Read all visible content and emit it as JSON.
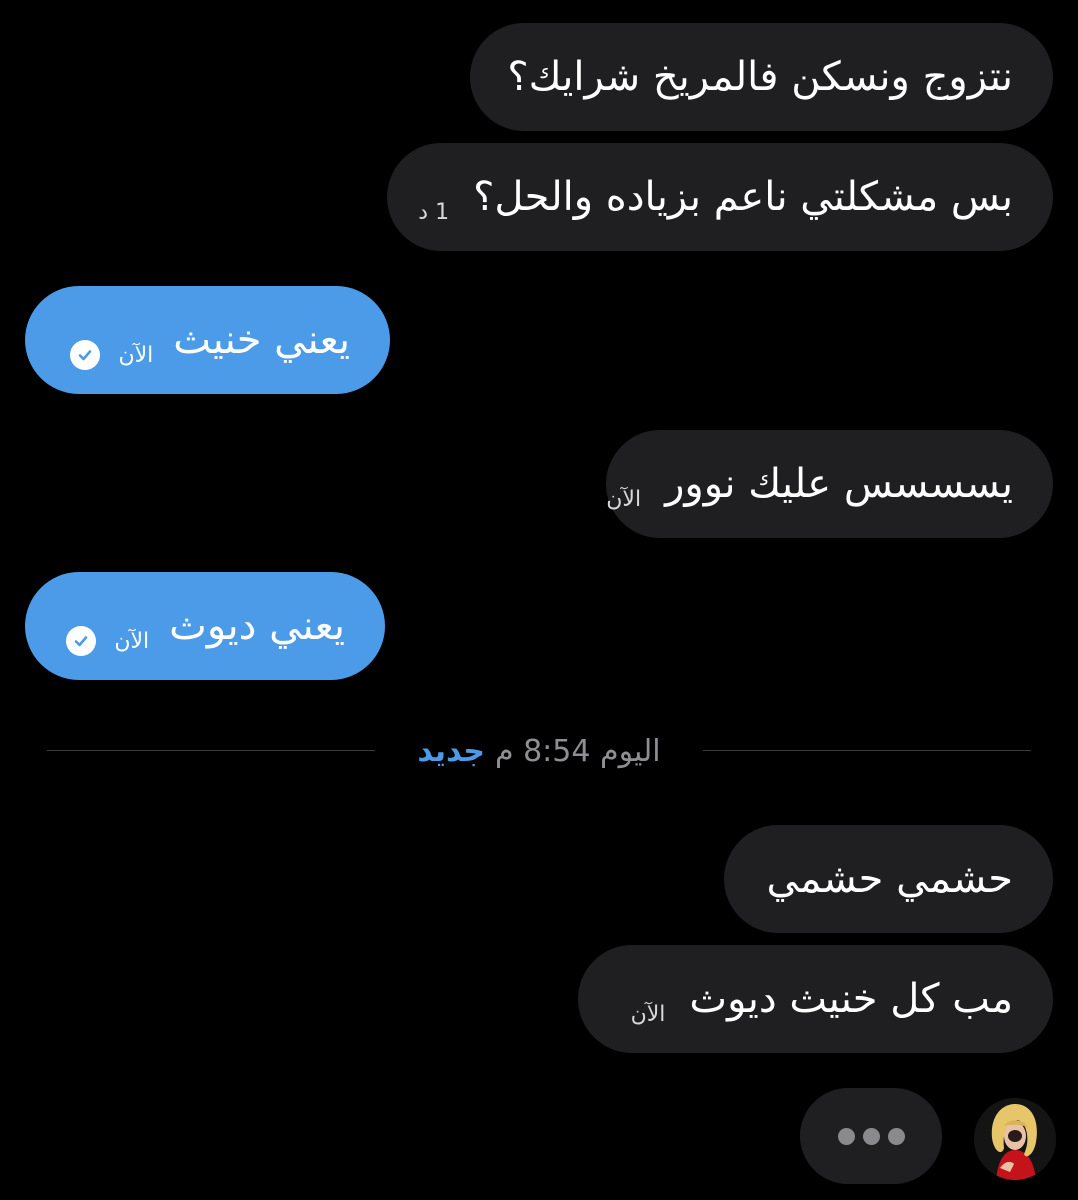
{
  "messages": [
    {
      "side": "incoming",
      "text": "نتزوج ونسكن فالمريخ شرايك؟",
      "time": ""
    },
    {
      "side": "incoming",
      "text": "بس مشكلتي ناعم بزياده والحل؟",
      "time": "1 د"
    },
    {
      "side": "outgoing",
      "text": "يعني خنيث",
      "time": "الآن",
      "status_icon": "read-check-icon"
    },
    {
      "side": "incoming",
      "text": "يسسسس عليك نوور",
      "time": "الآن"
    },
    {
      "side": "outgoing",
      "text": "يعني ديوث",
      "time": "الآن",
      "status_icon": "read-check-icon"
    },
    {
      "side": "incoming",
      "text": "حشمي حشمي",
      "time": ""
    },
    {
      "side": "incoming",
      "text": "مب كل خنيث ديوث",
      "time": "الآن"
    }
  ],
  "divider": {
    "date_label": "اليوم 8:54 م",
    "new_label": "جديد"
  },
  "typing_indicator": {
    "icon": "typing-dots-icon"
  },
  "colors": {
    "background": "#000000",
    "incoming_bubble": "#1f1f22",
    "outgoing_bubble": "#4c9be8",
    "accent": "#4c9be8",
    "muted_text": "#8e8e93"
  }
}
